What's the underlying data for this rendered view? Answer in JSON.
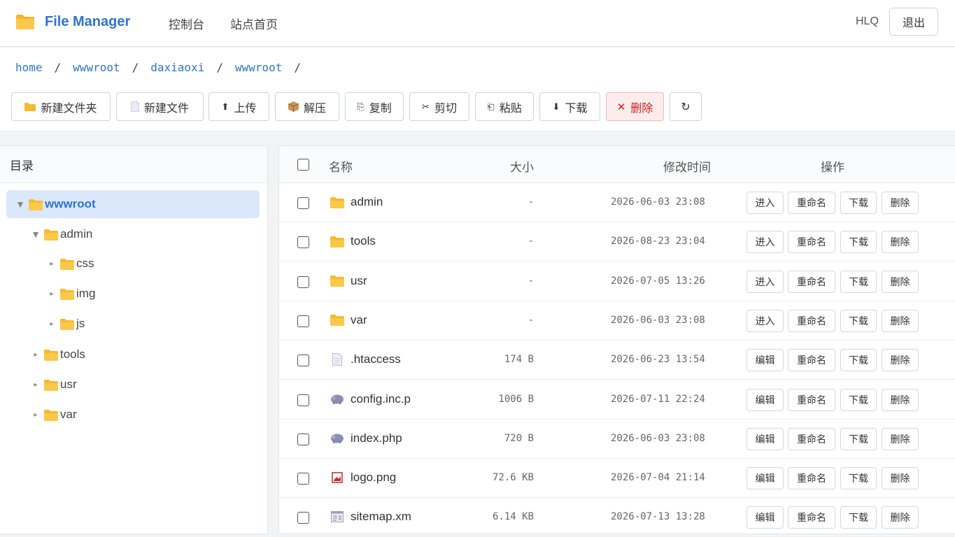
{
  "header": {
    "app_title": "File Manager",
    "nav": [
      "控制台",
      "站点首页"
    ],
    "user": "HLQ",
    "logout_label": "退出"
  },
  "breadcrumb": [
    "home",
    "wwwroot",
    "daxiaoxi",
    "wwwroot"
  ],
  "breadcrumb_separator": "/",
  "toolbar": {
    "new_folder": "新建文件夹",
    "new_file": "新建文件",
    "upload": "上传",
    "extract": "解压",
    "copy": "复制",
    "cut": "剪切",
    "paste": "粘贴",
    "download": "下载",
    "delete": "删除",
    "refresh": "↻"
  },
  "tree": {
    "title": "目录",
    "items": [
      {
        "label": "wwwroot",
        "selected": true,
        "expanded": true
      },
      {
        "label": "admin",
        "expanded": true
      },
      {
        "label": "css"
      },
      {
        "label": "img"
      },
      {
        "label": "js"
      },
      {
        "label": "tools"
      },
      {
        "label": "usr"
      },
      {
        "label": "var"
      }
    ]
  },
  "table": {
    "headers": {
      "name": "名称",
      "size": "大小",
      "mtime": "修改时间",
      "actions": "操作"
    },
    "rows": [
      {
        "name": "admin",
        "type": "folder",
        "size": "-",
        "mtime": "2026-06-03 23:08",
        "primary": "进入"
      },
      {
        "name": "tools",
        "type": "folder",
        "size": "-",
        "mtime": "2026-08-23 23:04",
        "primary": "进入"
      },
      {
        "name": "usr",
        "type": "folder",
        "size": "-",
        "mtime": "2026-07-05 13:26",
        "primary": "进入"
      },
      {
        "name": "var",
        "type": "folder",
        "size": "-",
        "mtime": "2026-06-03 23:08",
        "primary": "进入"
      },
      {
        "name": ".htaccess",
        "type": "file",
        "size": "174 B",
        "mtime": "2026-06-23 13:54",
        "primary": "编辑"
      },
      {
        "name": "config.inc.p",
        "type": "php",
        "size": "1006 B",
        "mtime": "2026-07-11 22:24",
        "primary": "编辑"
      },
      {
        "name": "index.php",
        "type": "php",
        "size": "720 B",
        "mtime": "2026-06-03 23:08",
        "primary": "编辑"
      },
      {
        "name": "logo.png",
        "type": "image",
        "size": "72.6 KB",
        "mtime": "2026-07-04 21:14",
        "primary": "编辑"
      },
      {
        "name": "sitemap.xm",
        "type": "xml",
        "size": "6.14 KB",
        "mtime": "2026-07-13 13:28",
        "primary": "编辑"
      }
    ],
    "action_labels": {
      "rename": "重命名",
      "download": "下载",
      "delete": "删除"
    }
  },
  "colors": {
    "accent": "#2f74d0",
    "folder": "#f7b92f",
    "danger": "#c82020"
  }
}
